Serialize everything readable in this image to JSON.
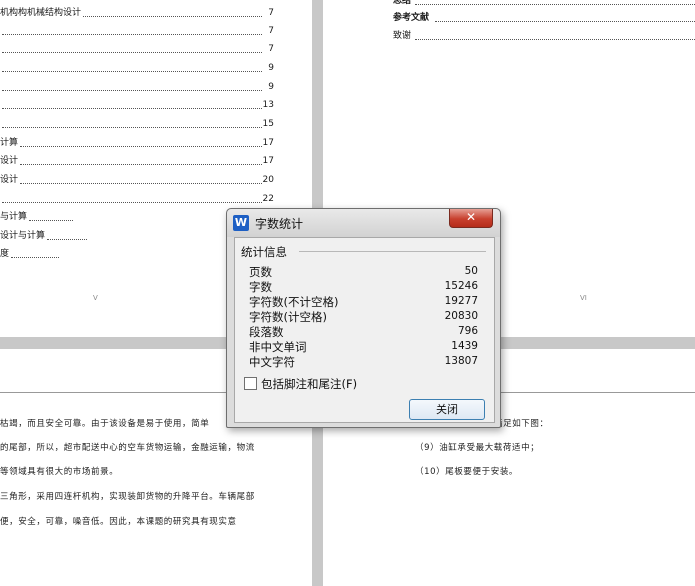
{
  "toc_left": [
    {
      "text": "机构构机械结构设计",
      "page": "7"
    },
    {
      "text": "",
      "page": "7"
    },
    {
      "text": "",
      "page": "7"
    },
    {
      "text": "",
      "page": "9"
    },
    {
      "text": "",
      "page": "9"
    },
    {
      "text": "",
      "page": "13"
    },
    {
      "text": "",
      "page": "15"
    },
    {
      "text": "计算",
      "page": "17"
    },
    {
      "text": "设计",
      "page": "17"
    },
    {
      "text": "设计",
      "page": "20"
    },
    {
      "text": "",
      "page": "22"
    },
    {
      "text": "与计算",
      "page": ""
    },
    {
      "text": "设计与计算",
      "page": ""
    },
    {
      "text": "度",
      "page": ""
    }
  ],
  "toc_right": [
    {
      "text": "总结",
      "bold": true
    },
    {
      "text": "参考文献",
      "bold": true
    },
    {
      "text": "致谢",
      "bold": false
    }
  ],
  "page_numbers": {
    "left": "V",
    "right": "VI"
  },
  "body_left": [
    "枯竭，而且安全可靠。由于该设备是易于使用，简单",
    "的尾部，所以，超市配送中心的空车货物运输，金融运输，物流",
    "等领域具有很大的市场前景。",
    "三角形，采用四连杆机构，实现装卸货物的升降平台。车辆尾部",
    "便，安全，可靠，噪音低。因此，本课题的研究具有现实意"
  ],
  "body_right": [
    "满足如下图：",
    "（9）油缸承受最大载荷适中；",
    "（10）尾板要便于安装。"
  ],
  "dialog": {
    "title": "字数统计",
    "close_glyph": "✕",
    "group_title": "统计信息",
    "stats": [
      {
        "label": "页数",
        "value": "50"
      },
      {
        "label": "字数",
        "value": "15246"
      },
      {
        "label": "字符数(不计空格)",
        "value": "19277"
      },
      {
        "label": "字符数(计空格)",
        "value": "20830"
      },
      {
        "label": "段落数",
        "value": "796"
      },
      {
        "label": "非中文单词",
        "value": "1439"
      },
      {
        "label": "中文字符",
        "value": "13807"
      }
    ],
    "checkbox_label": "包括脚注和尾注(F)",
    "checkbox_checked": false,
    "close_button": "关闭"
  }
}
